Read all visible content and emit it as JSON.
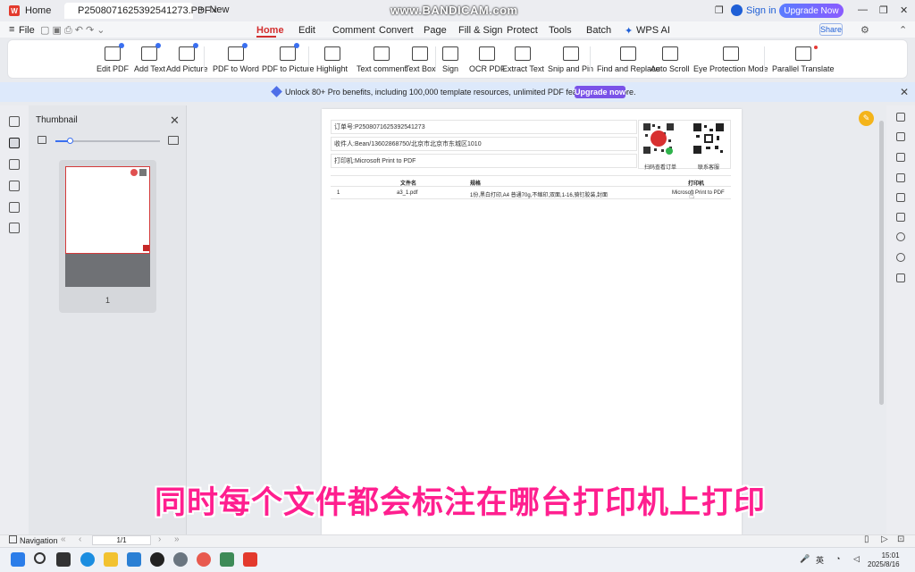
{
  "titlebar": {
    "home_tab": "Home",
    "doc_tab": "P2508071625392541273.PDF",
    "new_tab": "New",
    "watermark": "www.BANDICAM.com",
    "sign_in": "Sign in",
    "upgrade": "Upgrade Now"
  },
  "menubar": {
    "file": "File",
    "items": [
      "Home",
      "Edit",
      "Comment",
      "Convert",
      "Page",
      "Fill & Sign",
      "Protect",
      "Tools",
      "Batch",
      "WPS AI"
    ],
    "share": "Share"
  },
  "ribbon": {
    "tools": [
      "Edit PDF",
      "Add Text",
      "Add Picture",
      "PDF to Word",
      "PDF to Picture",
      "Highlight",
      "Text comment",
      "Text Box",
      "Sign",
      "OCR PDF",
      "Extract Text",
      "Snip and Pin",
      "Find and Replace",
      "Auto Scroll",
      "Eye Protection Mode",
      "Parallel Translate"
    ]
  },
  "banner": {
    "text": "Unlock 80+ Pro benefits, including 100,000 template resources, unlimited PDF features, and more.",
    "button": "Upgrade now"
  },
  "thumbnail_panel": {
    "title": "Thumbnail",
    "page_number": "1"
  },
  "document": {
    "order_label": "订单号:",
    "order_value": "P2508071625392541273",
    "recipient_label": "收件人:",
    "recipient_value": "Bean/13602868750/北京市北京市东城区1010",
    "printer_label": "打印机:",
    "printer_value": "Microsoft Print to PDF",
    "qr_caption_left": "扫码查看订单",
    "qr_caption_right": "联系客服",
    "table": {
      "headers": [
        "文件名",
        "规格",
        "打印机"
      ],
      "rows": [
        [
          "1",
          "a3_1.pdf",
          "1份,黑白打印,A4 普通70g,不缩印,双面,1-16,骑钉胶装,封面",
          "Microsoft Print to PDF"
        ]
      ]
    }
  },
  "subtitle": "同时每个文件都会标注在哪台打印机上打印",
  "statusbar": {
    "navigation": "Navigation",
    "page_indicator": "1/1"
  },
  "taskbar": {
    "time": "15:01",
    "date": "2025/8/16",
    "ime": "英"
  },
  "colors": {
    "accent": "#d32f2f",
    "primary_blue": "#3a6ff0",
    "upgrade_purple": "#7a52e8",
    "subtitle": "#ff1f8f"
  }
}
